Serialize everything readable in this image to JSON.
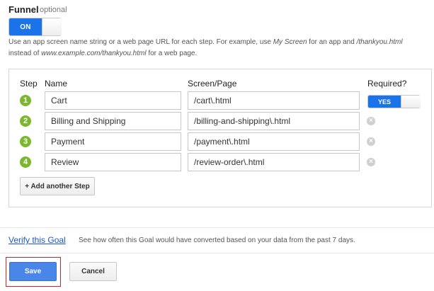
{
  "funnel": {
    "title": "Funnel",
    "optional_label": "optional",
    "toggle_label": "ON"
  },
  "help": {
    "line1_a": "Use an app screen name string or a web page URL for each step. For example, use ",
    "line1_b": "My Screen",
    "line1_c": " for an app and ",
    "line1_d": "/thankyou.html",
    "line2_a": "instead of ",
    "line2_b": "www.example.com/thankyou.html",
    "line2_c": " for a web page."
  },
  "table": {
    "headers": {
      "step": "Step",
      "name": "Name",
      "screen": "Screen/Page",
      "required": "Required?"
    },
    "rows": [
      {
        "step": "1",
        "name": "Cart",
        "screen": "/cart\\.html",
        "required": "YES"
      },
      {
        "step": "2",
        "name": "Billing and Shipping",
        "screen": "/billing-and-shipping\\.html"
      },
      {
        "step": "3",
        "name": "Payment",
        "screen": "/payment\\.html"
      },
      {
        "step": "4",
        "name": "Review",
        "screen": "/review-order\\.html"
      }
    ],
    "add_step_label": "+ Add another Step",
    "remove_icon": "close-circle-icon"
  },
  "verify": {
    "link_label": "Verify this Goal",
    "description": "See how often this Goal would have converted based on your data from the past 7 days."
  },
  "actions": {
    "save_label": "Save",
    "cancel_label": "Cancel"
  },
  "colors": {
    "primary": "#1a73e8",
    "save": "#4a86e8",
    "step_badge": "#7cb82f",
    "highlight": "#c62828",
    "link": "#1a56c9"
  }
}
